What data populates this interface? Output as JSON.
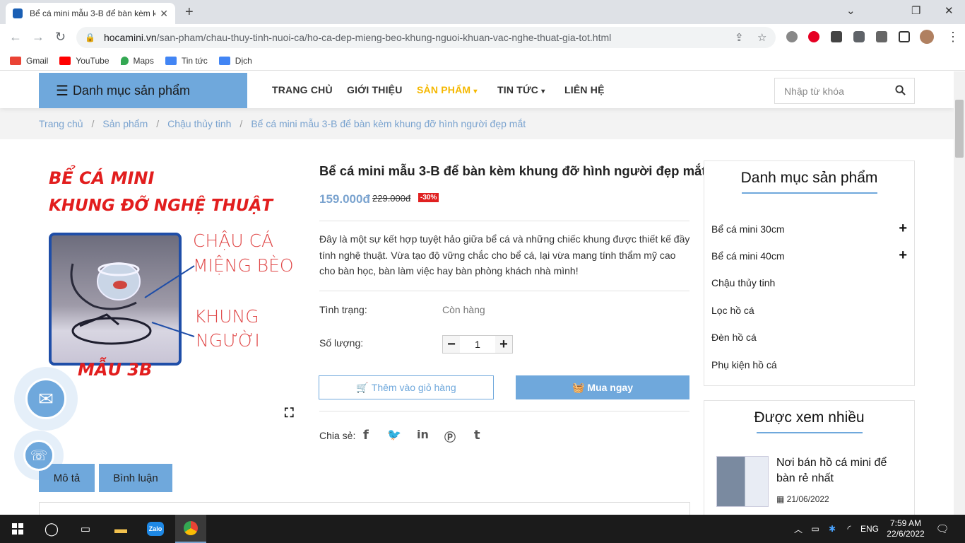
{
  "browser": {
    "tab_title": "Bể cá mini mẫu 3-B để bàn kèm k",
    "url_host": "hocamini.vn",
    "url_path": "/san-pham/chau-thuy-tinh-nuoi-ca/ho-ca-dep-mieng-beo-khung-nguoi-khuan-vac-nghe-thuat-gia-tot.html",
    "bookmarks": [
      {
        "label": "Gmail",
        "color": "#ea4335"
      },
      {
        "label": "YouTube",
        "color": "#ff0000"
      },
      {
        "label": "Maps",
        "color": "#34a853"
      },
      {
        "label": "Tin tức",
        "color": "#4285f4"
      },
      {
        "label": "Dịch",
        "color": "#4285f4"
      }
    ]
  },
  "site": {
    "category_button": "Danh mục sản phẩm",
    "menu": [
      "TRANG CHỦ",
      "GIỚI THIỆU",
      "SẢN PHẨM",
      "TIN TỨC",
      "LIÊN HỆ"
    ],
    "search_placeholder": "Nhập từ khóa",
    "accent": "#6fa8dc",
    "highlight": "#f5b800"
  },
  "breadcrumb": [
    "Trang chủ",
    "Sản phẩm",
    "Chậu thủy tinh",
    "Bể cá mini mẫu 3-B để bàn kèm khung đỡ hình người đẹp mắt"
  ],
  "image_text": {
    "line1": "BỂ CÁ MINI",
    "line2": "KHUNG ĐỠ NGHỆ THUẬT",
    "anno1a": "CHẬU CÁ",
    "anno1b": "MIỆNG BÈO",
    "anno2a": "KHUNG",
    "anno2b": "NGƯỜI",
    "model": "MẪU 3B"
  },
  "product": {
    "title": "Bể cá mini mẫu 3-B để bàn kèm khung đỡ hình người đẹp mắt",
    "price": "159.000đ",
    "old_price": "229.000đ",
    "discount": "-30%",
    "description": "Đây là một sự kết hợp tuyệt hảo giữa bể cá và những chiếc khung được thiết kế đầy tính nghệ thuật. Vừa tạo độ vững chắc cho bể cá, lại vừa mang tính thẩm mỹ cao cho bàn học, bàn làm việc hay bàn phòng khách nhà mình!",
    "status_label": "Tình trạng:",
    "status_value": "Còn hàng",
    "qty_label": "Số lượng:",
    "qty_value": "1",
    "add_to_cart": "Thêm vào giỏ hàng",
    "buy_now": "Mua ngay",
    "share_label": "Chia sẻ:"
  },
  "tabs": [
    "Mô tả",
    "Bình luận"
  ],
  "sidebar": {
    "categories_title": "Danh mục sản phẩm",
    "categories": [
      {
        "label": "Bể cá mini 30cm",
        "expand": true
      },
      {
        "label": "Bể cá mini 40cm",
        "expand": true
      },
      {
        "label": "Chậu thủy tinh",
        "expand": false
      },
      {
        "label": "Lọc hồ cá",
        "expand": false
      },
      {
        "label": "Đèn hồ cá",
        "expand": false
      },
      {
        "label": "Phụ kiện hồ cá",
        "expand": false
      }
    ],
    "popular_title": "Được xem nhiều",
    "popular_post_title": "Nơi bán hồ cá mini để bàn rẻ nhất",
    "popular_post_date": "21/06/2022"
  },
  "taskbar": {
    "lang": "ENG",
    "time": "7:59 AM",
    "date": "22/6/2022",
    "zalo": "Zalo"
  }
}
